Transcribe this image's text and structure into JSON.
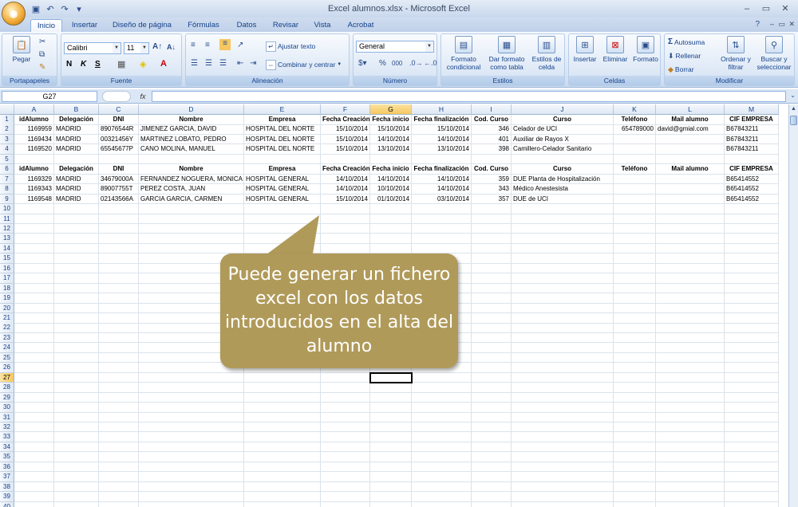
{
  "window": {
    "title": "Excel alumnos.xlsx - Microsoft Excel"
  },
  "tabs": [
    "Inicio",
    "Insertar",
    "Diseño de página",
    "Fórmulas",
    "Datos",
    "Revisar",
    "Vista",
    "Acrobat"
  ],
  "ribbon": {
    "portapapeles": {
      "label": "Portapapeles",
      "pegar": "Pegar"
    },
    "fuente": {
      "label": "Fuente",
      "font": "Calibri",
      "size": "11",
      "bold": "N",
      "italic": "K",
      "underline": "S"
    },
    "alineacion": {
      "label": "Alineación",
      "wrap": "Ajustar texto",
      "merge": "Combinar y centrar"
    },
    "numero": {
      "label": "Número",
      "format": "General",
      "percent": "%",
      "thousands": "000"
    },
    "estilos": {
      "label": "Estilos",
      "cond": "Formato condicional",
      "table": "Dar formato como tabla",
      "cell": "Estilos de celda"
    },
    "celdas": {
      "label": "Celdas",
      "insert": "Insertar",
      "delete": "Eliminar",
      "format": "Formato"
    },
    "modificar": {
      "label": "Modificar",
      "autosum": "Autosuma",
      "fill": "Rellenar",
      "clear": "Borrar",
      "sort": "Ordenar y filtrar",
      "find": "Buscar y seleccionar"
    }
  },
  "formula_bar": {
    "name_box": "G27",
    "fx": "fx",
    "value": ""
  },
  "columns": [
    "A",
    "B",
    "C",
    "D",
    "E",
    "F",
    "G",
    "H",
    "I",
    "J",
    "K",
    "L",
    "M"
  ],
  "headers": [
    "idAlumno",
    "Delegación",
    "DNI",
    "Nombre",
    "Empresa",
    "Fecha Creación",
    "Fecha inicio",
    "Fecha finalización",
    "Cod. Curso",
    "Curso",
    "Teléfono",
    "Mail alumno",
    "CIF EMPRESA"
  ],
  "rows_top": [
    [
      "1169959",
      "MADRID",
      "89076544R",
      "JIMENEZ GARCIA, DAVID",
      "HOSPITAL DEL NORTE",
      "15/10/2014",
      "15/10/2014",
      "15/10/2014",
      "346",
      "Celador de UCI",
      "654789000",
      "david@gmial.com",
      "B67843211"
    ],
    [
      "1169434",
      "MADRID",
      "00321456Y",
      "MARTINEZ LOBATO, PEDRO",
      "HOSPITAL DEL NORTE",
      "15/10/2014",
      "14/10/2014",
      "14/10/2014",
      "401",
      "Auxiliar de Rayos X",
      "",
      "",
      "B67843211"
    ],
    [
      "1169520",
      "MADRID",
      "65545677P",
      "CANO MOLINA, MANUEL",
      "HOSPITAL DEL NORTE",
      "15/10/2014",
      "13/10/2014",
      "13/10/2014",
      "398",
      "Camillero-Celador Sanitario",
      "",
      "",
      "B67843211"
    ]
  ],
  "rows_bottom": [
    [
      "1169329",
      "MADRID",
      "34679000A",
      "FERNANDEZ NOGUERA, MONICA",
      "HOSPITAL GENERAL",
      "14/10/2014",
      "14/10/2014",
      "14/10/2014",
      "359",
      "DUE Planta de Hospitalización",
      "",
      "",
      "B65414552"
    ],
    [
      "1169343",
      "MADRID",
      "89007755T",
      "PEREZ COSTA, JUAN",
      "HOSPITAL GENERAL",
      "14/10/2014",
      "10/10/2014",
      "14/10/2014",
      "343",
      "Médico Anestesista",
      "",
      "",
      "B65414552"
    ],
    [
      "1169548",
      "MADRID",
      "02143566A",
      "GARCIA GARCIA, CARMEN",
      "HOSPITAL GENERAL",
      "15/10/2014",
      "01/10/2014",
      "03/10/2014",
      "357",
      "DUE de UCI",
      "",
      "",
      "B65414552"
    ]
  ],
  "selected": {
    "column": "G",
    "row": "27"
  },
  "callout": {
    "text": "Puede generar un fichero excel con los datos introducidos en el alta del alumno",
    "color": "#b09a5a"
  }
}
